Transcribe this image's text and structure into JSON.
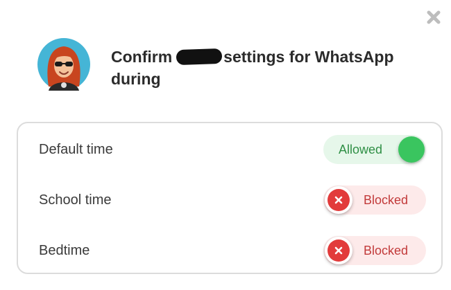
{
  "dialog": {
    "title_before": "Confirm",
    "title_after": "settings for WhatsApp during"
  },
  "colors": {
    "allowed_bg": "#e6f7ea",
    "allowed_knob": "#3ac55f",
    "blocked_bg": "#fdeaea",
    "blocked_x": "#e23b3b"
  },
  "rows": [
    {
      "label": "Default time",
      "status": "Allowed",
      "state": "on"
    },
    {
      "label": "School time",
      "status": "Blocked",
      "state": "off"
    },
    {
      "label": "Bedtime",
      "status": "Blocked",
      "state": "off"
    }
  ]
}
